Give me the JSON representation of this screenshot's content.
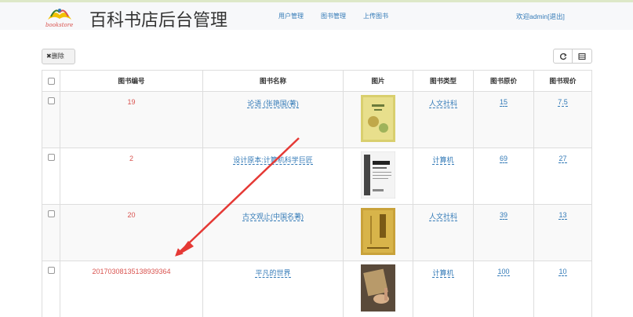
{
  "header": {
    "logo_text": "bookstore",
    "title": "百科书店后台管理",
    "nav": [
      {
        "label": "用户管理"
      },
      {
        "label": "图书管理"
      },
      {
        "label": "上传图书"
      }
    ],
    "welcome": "欢迎admin[退出]"
  },
  "toolbar": {
    "delete_label": "删除",
    "refresh_icon": "refresh-icon",
    "columns_icon": "columns-icon"
  },
  "table": {
    "columns": [
      "图书编号",
      "图书名称",
      "图片",
      "图书类型",
      "图书原价",
      "图书现价"
    ],
    "rows": [
      {
        "id": "19",
        "name": "论语 (张艳国(著)",
        "type": "人文社科",
        "original_price": "15",
        "current_price": "7.5"
      },
      {
        "id": "2",
        "name": "设计原本:计算机科学巨匠",
        "type": "计算机",
        "original_price": "69",
        "current_price": "27"
      },
      {
        "id": "20",
        "name": "古文观止(中国名著)",
        "type": "人文社科",
        "original_price": "39",
        "current_price": "13"
      },
      {
        "id": "20170308135138939364",
        "name": "平凡的世界",
        "type": "计算机",
        "original_price": "100",
        "current_price": "10"
      }
    ]
  },
  "colors": {
    "link": "#337ab7",
    "id_text": "#d9534f",
    "annotation_arrow": "#e53935"
  }
}
